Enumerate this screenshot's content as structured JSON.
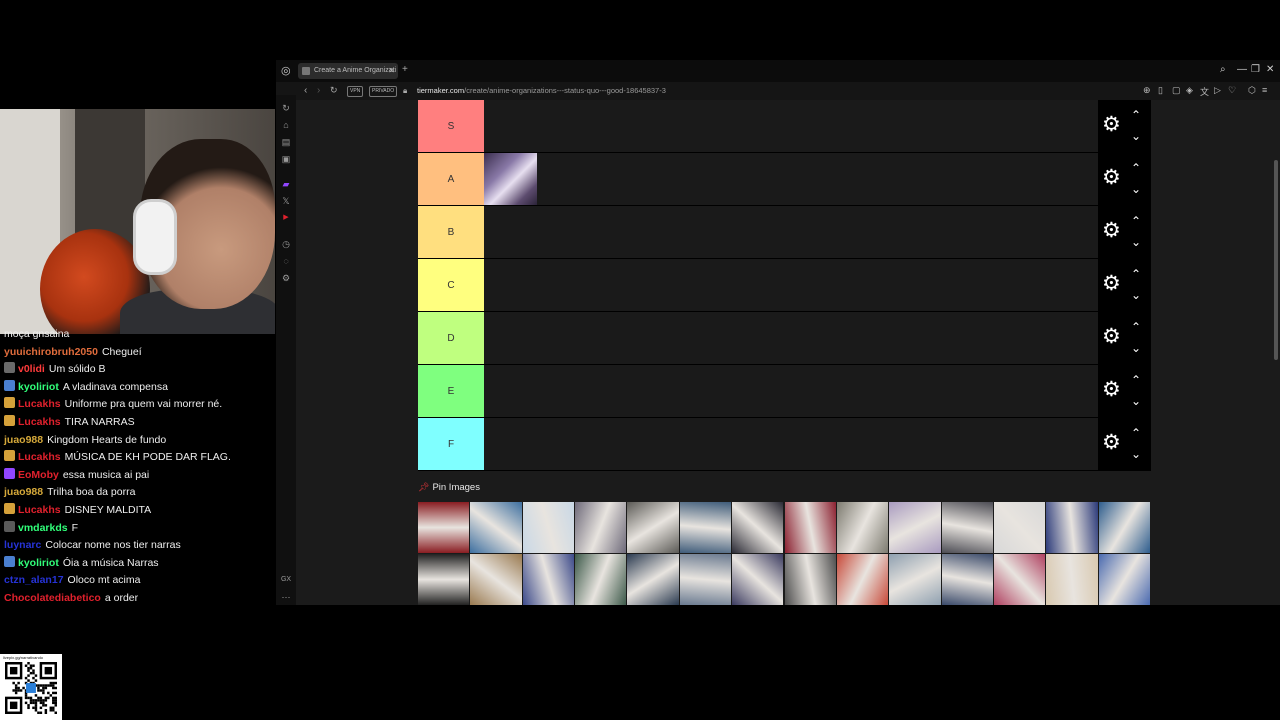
{
  "browser": {
    "tab_title": "Create a Anime Organizati",
    "url_host": "tiermaker.com",
    "url_path": "/create/anime-organizations---status-quo---good-18645837-3",
    "badges": [
      "VPN",
      "PRIVADO"
    ]
  },
  "tierlist": {
    "tiers": [
      {
        "label": "S",
        "color": "#ff7f7f",
        "items": 0
      },
      {
        "label": "A",
        "color": "#ffbf7f",
        "items": 1
      },
      {
        "label": "B",
        "color": "#ffdf7f",
        "items": 0
      },
      {
        "label": "C",
        "color": "#ffff7f",
        "items": 0
      },
      {
        "label": "D",
        "color": "#bfff7f",
        "items": 0
      },
      {
        "label": "E",
        "color": "#7fff7f",
        "items": 0
      },
      {
        "label": "F",
        "color": "#7fffff",
        "items": 0
      }
    ],
    "tier_settings_icon": "gear-icon",
    "move_up_icon": "chevron-up-icon",
    "move_down_icon": "chevron-down-icon"
  },
  "pool": {
    "title": "Pin Images",
    "pin_icon": "pushpin-icon",
    "thumb_colors": [
      [
        "#8a1d22",
        "#3d6fa0",
        "#c9d8e6",
        "#6e6a7a",
        "#5b5a56",
        "#3f5c7a",
        "#2a2a35",
        "#8b2030",
        "#7d7b70",
        "#a99bc0",
        "#4c4c54",
        "#d8d8d8",
        "#2b3a7a",
        "#2e5d8e"
      ],
      [
        "#222222",
        "#9a7a50",
        "#3c4a8a",
        "#3d5a4a",
        "#2a3a50",
        "#6a7a90",
        "#3b3b60",
        "#4d4d4d",
        "#c84a3a",
        "#8fa0b0",
        "#3a4a6a",
        "#b04060",
        "#d9c9b0",
        "#4a6ab0"
      ]
    ]
  },
  "chat": {
    "partial_top": "moça gnsaina",
    "messages": [
      {
        "user": "yuuichirobruh2050",
        "color": "#e06c3c",
        "badge": "",
        "text": "Chegueí"
      },
      {
        "user": "v0lidi",
        "color": "#ff3b3b",
        "badge": "#6a6a6a",
        "text": "Um sólido B"
      },
      {
        "user": "kyoliriot",
        "color": "#31ff7a",
        "badge": "#4a7fd0",
        "text": "A vladinava compensa"
      },
      {
        "user": "Lucakhs",
        "color": "#e0212d",
        "badge": "#d5a13a",
        "text": "Uniforme pra quem vai morrer né."
      },
      {
        "user": "Lucakhs",
        "color": "#e0212d",
        "badge": "#d5a13a",
        "text": "TIRA NARRAS"
      },
      {
        "user": "juao988",
        "color": "#d6a93a",
        "badge": "",
        "text": "Kingdom Hearts de fundo"
      },
      {
        "user": "Lucakhs",
        "color": "#e0212d",
        "badge": "#d5a13a",
        "text": "MÚSICA DE KH PODE DAR FLAG."
      },
      {
        "user": "EoMoby",
        "color": "#e0212d",
        "badge": "#9146ff",
        "text": "essa musica ai pai"
      },
      {
        "user": "juao988",
        "color": "#d6a93a",
        "badge": "",
        "text": "Trilha boa da porra"
      },
      {
        "user": "Lucakhs",
        "color": "#e0212d",
        "badge": "#d5a13a",
        "text": "DISNEY MALDITA"
      },
      {
        "user": "vmdarkds",
        "color": "#31ff7a",
        "badge": "#5a5a5a",
        "text": "F"
      },
      {
        "user": "luynarc",
        "color": "#2633d6",
        "badge": "",
        "text": "Colocar nome nos tier narras"
      },
      {
        "user": "kyoliriot",
        "color": "#31ff7a",
        "badge": "#4a7fd0",
        "text": "Óia a música Narras"
      },
      {
        "user": "ctzn_alan17",
        "color": "#2633d6",
        "badge": "",
        "text": "Oloco mt acima"
      },
      {
        "user": "Chocolatediabetico",
        "color": "#e0212d",
        "badge": "",
        "text": "a order"
      }
    ]
  },
  "qr": {
    "caption": "livepix.gg/narrativando"
  }
}
